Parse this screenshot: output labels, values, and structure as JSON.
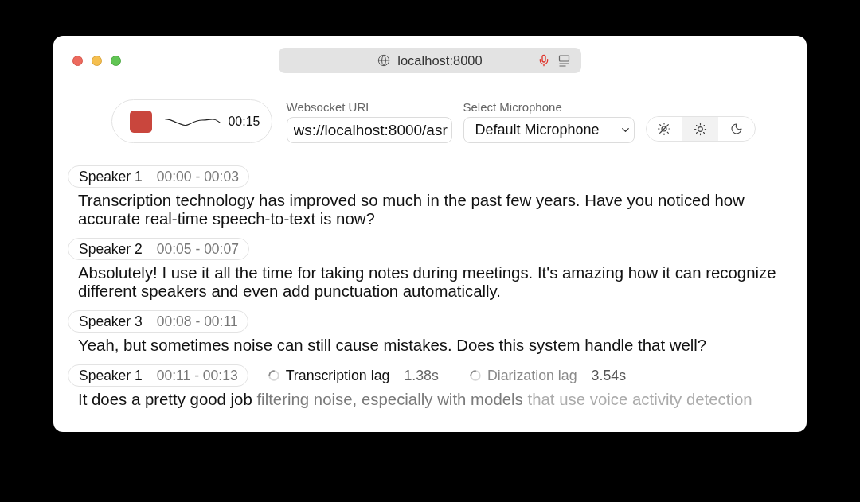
{
  "browser": {
    "address": "localhost:8000"
  },
  "recorder": {
    "recording": true,
    "elapsed": "00:15"
  },
  "websocket": {
    "label": "Websocket URL",
    "value": "ws://localhost:8000/asr"
  },
  "microphone": {
    "label": "Select Microphone",
    "value": "Default Microphone"
  },
  "theme_options": [
    {
      "kind": "system",
      "selected": false
    },
    {
      "kind": "light",
      "selected": true
    },
    {
      "kind": "dark",
      "selected": false
    }
  ],
  "transcript": [
    {
      "speaker": "Speaker 1",
      "time": "00:00 - 00:03",
      "segments": [
        {
          "kind": "final",
          "text": "Transcription technology has improved so much in the past few years. Have you noticed how accurate real-time speech-to-text is now?"
        }
      ]
    },
    {
      "speaker": "Speaker 2",
      "time": "00:05 - 00:07",
      "segments": [
        {
          "kind": "final",
          "text": "Absolutely! I use it all the time for taking notes during meetings. It's amazing how it can recognize different speakers and even add punctuation automatically."
        }
      ]
    },
    {
      "speaker": "Speaker 3",
      "time": "00:08 - 00:11",
      "segments": [
        {
          "kind": "final",
          "text": "Yeah, but sometimes noise can still cause mistakes. Does this system handle that well?"
        }
      ]
    },
    {
      "speaker": "Speaker 1",
      "time": "00:11 - 00:13",
      "lags": [
        {
          "kind": "transcription",
          "label": "Transcription lag",
          "value": "1.38s"
        },
        {
          "kind": "diarization",
          "label": "Diarization lag",
          "value": "3.54s"
        }
      ],
      "segments": [
        {
          "kind": "final",
          "text": "It does a pretty good job"
        },
        {
          "kind": "diarization_buffer",
          "text": "filtering noise, especially with models"
        },
        {
          "kind": "transcription_buffer",
          "text": "that use voice activity detection"
        }
      ]
    }
  ]
}
